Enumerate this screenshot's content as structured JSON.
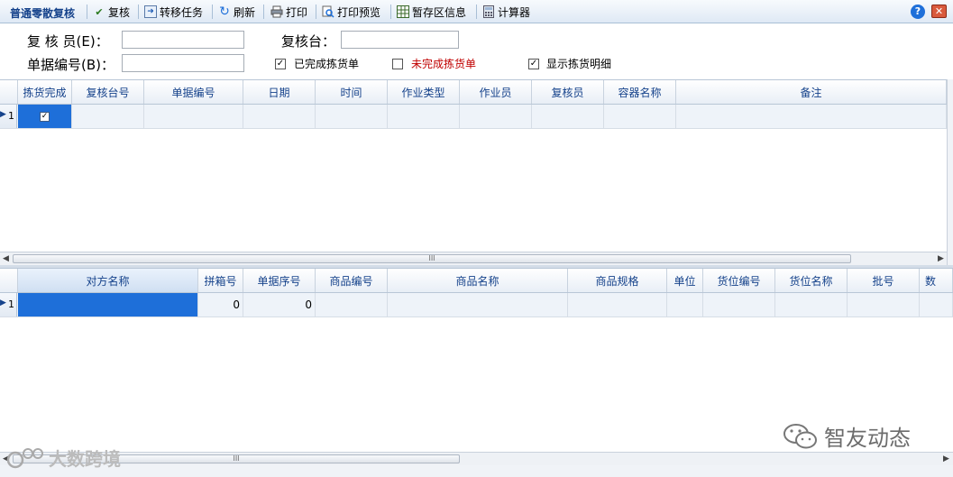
{
  "toolbar": {
    "title": "普通零散复核",
    "review": "复核",
    "transfer": "转移任务",
    "refresh": "刷新",
    "print": "打印",
    "print_preview": "打印预览",
    "staging_info": "暂存区信息",
    "calculator": "计算器"
  },
  "form": {
    "reviewer_label": "复 核 员(E)：",
    "reviewer_value": "",
    "desk_label": "复核台：",
    "desk_value": "",
    "docno_label": "单据编号(B)：",
    "docno_value": "",
    "completed_label": "已完成拣货单",
    "completed_checked": true,
    "uncompleted_label": "未完成拣货单",
    "uncompleted_checked": false,
    "show_detail_label": "显示拣货明细",
    "show_detail_checked": true,
    "uncompleted_color": "#c00000"
  },
  "grid1": {
    "columns": [
      "拣货完成",
      "复核台号",
      "单据编号",
      "日期",
      "时间",
      "作业类型",
      "作业员",
      "复核员",
      "容器名称",
      "备注"
    ],
    "rows": [
      {
        "num": "1",
        "picked": true,
        "cells": [
          "",
          "",
          "",
          "",
          "",
          "",
          "",
          "",
          ""
        ]
      }
    ]
  },
  "grid2": {
    "columns": [
      "对方名称",
      "拼箱号",
      "单据序号",
      "商品编号",
      "商品名称",
      "商品规格",
      "单位",
      "货位编号",
      "货位名称",
      "批号",
      "数"
    ],
    "rows": [
      {
        "num": "1",
        "cells": [
          "",
          "0",
          "0",
          "",
          "",
          "",
          "",
          "",
          "",
          "",
          ""
        ]
      }
    ]
  },
  "scroll_grip": "III",
  "watermark_left": "大数跨境",
  "watermark_right": "智友动态",
  "colors": {
    "accent": "#15428b",
    "selection": "#1e6fd9"
  }
}
